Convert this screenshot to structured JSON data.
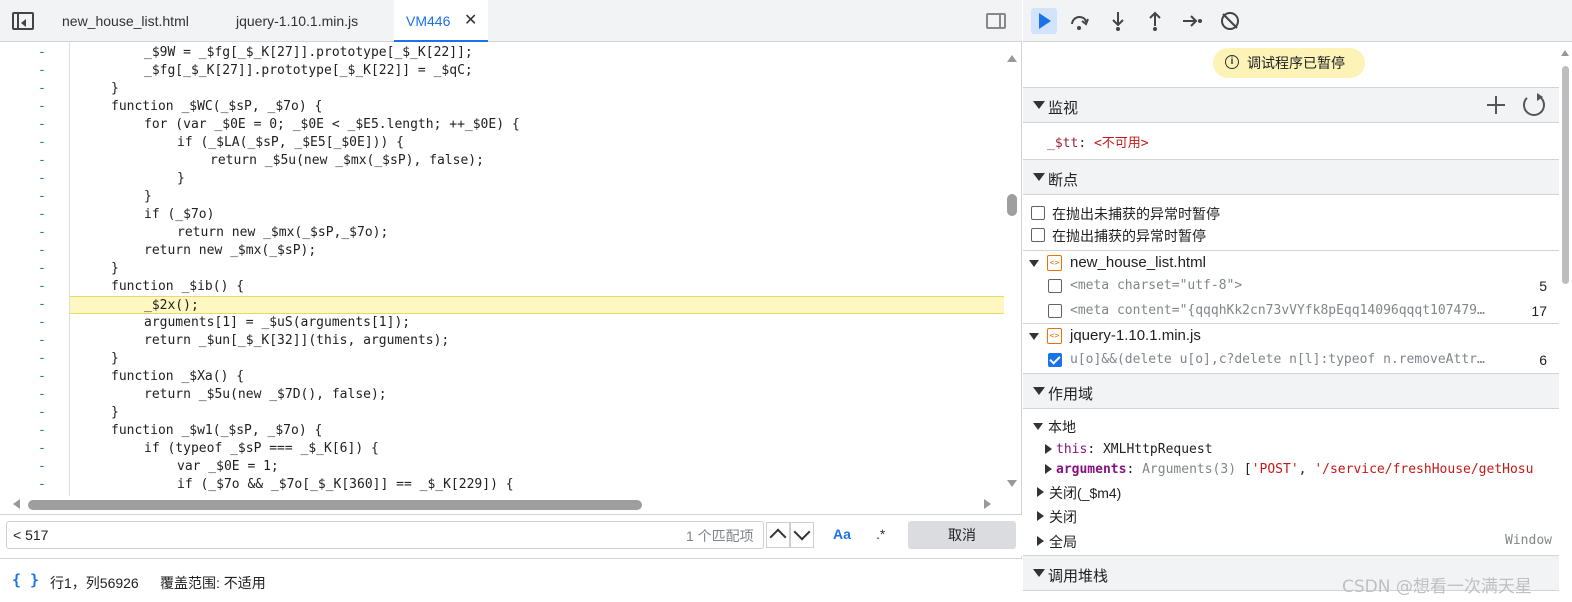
{
  "tabs": [
    {
      "label": "new_house_list.html"
    },
    {
      "label": "jquery-1.10.1.min.js"
    },
    {
      "label": "VM446"
    }
  ],
  "code": {
    "marker": "-",
    "lines": [
      "_$9W = _$fg[_$_K[27]].prototype[_$_K[22]];",
      "_$fg[_$_K[27]].prototype[_$_K[22]] = _$qC;",
      "}",
      "function _$WC(_$sP, _$7o) {",
      "for (var _$0E = 0; _$0E < _$E5.length; ++_$0E) {",
      "if (_$LA(_$sP, _$E5[_$0E])) {",
      "return _$5u(new _$mx(_$sP), false);",
      "}",
      "}",
      "if (_$7o)",
      "return new _$mx(_$sP,_$7o);",
      "return new _$mx(_$sP);",
      "}",
      "function _$ib() {",
      "_$2x();",
      "arguments[1] = _$uS(arguments[1]);",
      "return _$un[_$_K[32]](this, arguments);",
      "}",
      "function _$Xa() {",
      "return _$5u(new _$7D(), false);",
      "}",
      "function _$w1(_$sP, _$7o) {",
      "if (typeof _$sP === _$_K[6]) {",
      "var _$0E = 1;",
      "if (_$7o && _$7o[_$_K[360]] == _$_K[229]) {"
    ]
  },
  "search": {
    "value": "< 517",
    "match_count": "1 个匹配项",
    "case_option": "Aa",
    "regex_option": ".*",
    "cancel_label": "取消"
  },
  "status": {
    "braces": "{ }",
    "position": "行1，列56926",
    "coverage": "覆盖范围: 不适用"
  },
  "debugger": {
    "paused_label": "调试程序已暂停",
    "watch": {
      "title": "监视",
      "item_name": "_$tt",
      "item_value": "<不可用>"
    },
    "breakpoints": {
      "title": "断点",
      "uncaught_label": "在抛出未捕获的异常时暂停",
      "caught_label": "在抛出捕获的异常时暂停",
      "files": [
        {
          "name": "new_house_list.html",
          "items": [
            {
              "code": "<meta charset=\"utf-8\">",
              "line": "5",
              "checked": false
            },
            {
              "code": "<meta content=\"{qqqhKk2cn73vVYfk8pEqq14096qqqt107479…",
              "line": "17",
              "checked": false
            }
          ]
        },
        {
          "name": "jquery-1.10.1.min.js",
          "items": [
            {
              "code": "u[o]&&(delete u[o],c?delete n[l]:typeof n.removeAttr…",
              "line": "6",
              "checked": true
            }
          ]
        }
      ]
    },
    "scope": {
      "title": "作用域",
      "local_label": "本地",
      "this_name": "this",
      "this_value": "XMLHttpRequest",
      "args_name": "arguments",
      "args_type": "Arguments(3)",
      "args_open": "[",
      "args_v1": "'POST'",
      "args_sep": ", ",
      "args_v2": "'/service/freshHouse/getHosu",
      "closure1": "关闭(_$m4)",
      "closure2": "关闭",
      "global_label": "全局",
      "global_value": "Window"
    },
    "callstack_title": "调用堆栈"
  },
  "watermark": "CSDN @想看一次满天星"
}
